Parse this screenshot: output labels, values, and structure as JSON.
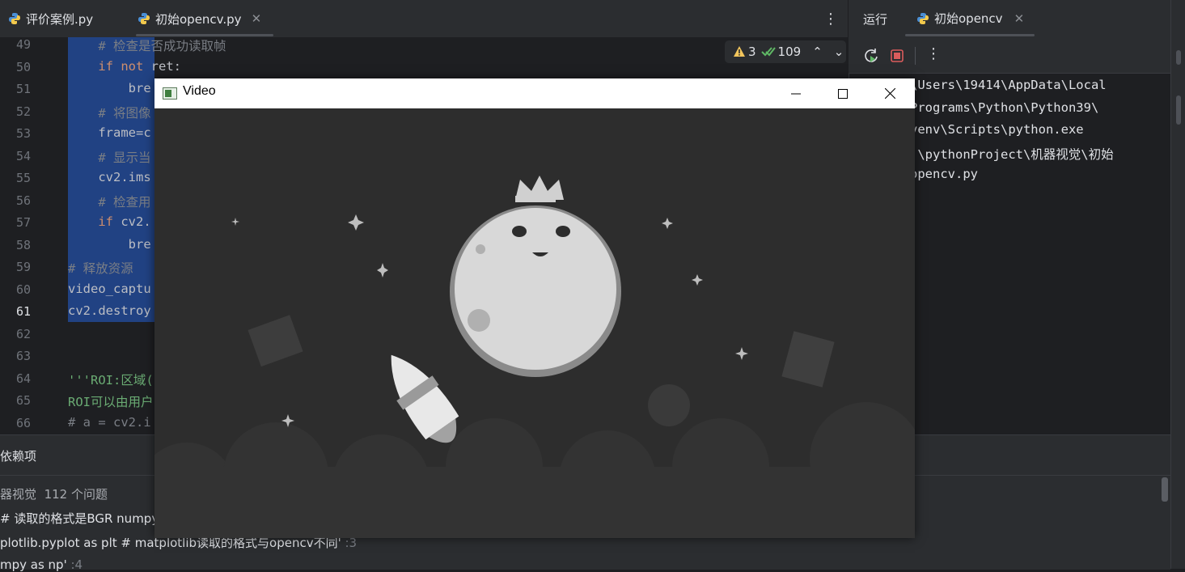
{
  "editor_tabs": [
    {
      "label": "评价案例.py",
      "active": false
    },
    {
      "label": "初始opencv.py",
      "active": true
    }
  ],
  "editor": {
    "lines": [
      {
        "num": "49",
        "text": "    # 检查是否成功读取帧",
        "kind": "comment"
      },
      {
        "num": "50",
        "text": "    if not ret:",
        "kind": "code"
      },
      {
        "num": "51",
        "text": "        bre",
        "kind": "code"
      },
      {
        "num": "52",
        "text": "    # 将图像",
        "kind": "comment"
      },
      {
        "num": "53",
        "text": "    frame=c",
        "kind": "code"
      },
      {
        "num": "54",
        "text": "    # 显示当",
        "kind": "comment"
      },
      {
        "num": "55",
        "text": "    cv2.ims",
        "kind": "code"
      },
      {
        "num": "56",
        "text": "    # 检查用",
        "kind": "comment"
      },
      {
        "num": "57",
        "text": "    if cv2.",
        "kind": "code"
      },
      {
        "num": "58",
        "text": "        bre",
        "kind": "code"
      },
      {
        "num": "59",
        "text": "# 释放资源",
        "kind": "comment"
      },
      {
        "num": "60",
        "text": "video_captu",
        "kind": "code"
      },
      {
        "num": "61",
        "text": "cv2.destroy",
        "kind": "code"
      },
      {
        "num": "62",
        "text": "",
        "kind": "code"
      },
      {
        "num": "63",
        "text": "",
        "kind": "code"
      },
      {
        "num": "64",
        "text": "'''ROI:区域(",
        "kind": "string"
      },
      {
        "num": "65",
        "text": "ROI可以由用户",
        "kind": "string"
      },
      {
        "num": "66",
        "text": "# a = cv2.i",
        "kind": "comment"
      }
    ],
    "current_line": "61",
    "inspection": {
      "warnings": "3",
      "checks": "109"
    }
  },
  "run_panel": {
    "tab_run": "运行",
    "tab_config": "初始opencv",
    "output_lines": [
      "\\Users\\19414\\AppData\\Local",
      "Programs\\Python\\Python39\\",
      "venv\\Scripts\\python.exe",
      ":\\pythonProject\\机器视觉\\初始",
      "opencv.py"
    ]
  },
  "bottom_panel": {
    "title": "依赖项",
    "summary_name": "器视觉",
    "summary_count": "112 个问题",
    "items": [
      {
        "text": "# 读取的格式是BGR numpy'",
        "suffix": ""
      },
      {
        "text": "plotlib.pyplot as plt # matplotlib读取的格式与opencv不同'",
        "suffix": ":3"
      },
      {
        "text": "mpy as np'",
        "suffix": ":4"
      }
    ]
  },
  "video_window": {
    "title": "Video"
  },
  "colors": {
    "selection": "#214283",
    "accent": "#3574f0",
    "stop_red": "#db5c5c",
    "run_green": "#5fb865",
    "warning_yellow": "#f2c55c"
  }
}
